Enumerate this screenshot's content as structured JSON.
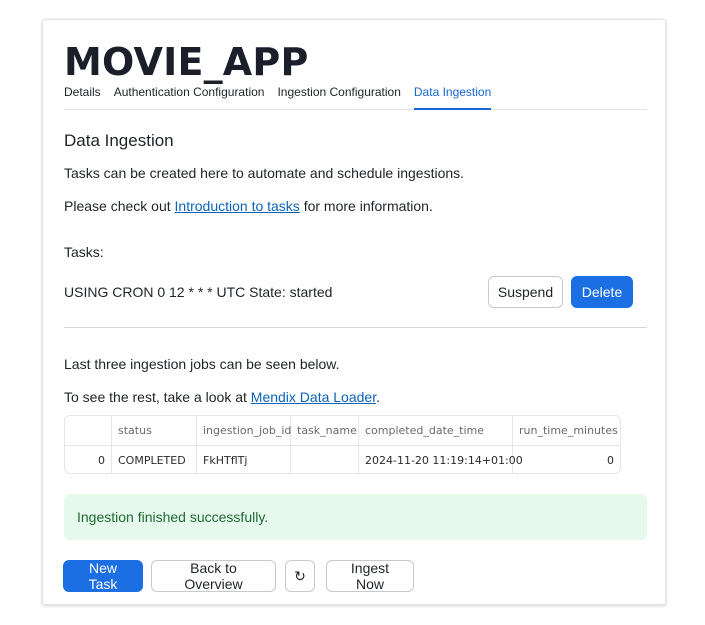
{
  "app": {
    "title": "MOVIE_APP"
  },
  "tabs": [
    {
      "label": "Details",
      "active": false
    },
    {
      "label": "Authentication Configuration",
      "active": false
    },
    {
      "label": "Ingestion Configuration",
      "active": false
    },
    {
      "label": "Data Ingestion",
      "active": true
    }
  ],
  "section": {
    "title": "Data Ingestion",
    "intro": "Tasks can be created here to automate and schedule ingestions.",
    "info_prefix": "Please check out ",
    "info_link": "Introduction to tasks",
    "info_suffix": " for more information."
  },
  "tasks": {
    "label": "Tasks:",
    "items": [
      {
        "description": "USING CRON 0 12 * * * UTC State: started",
        "suspend_label": "Suspend",
        "delete_label": "Delete"
      }
    ]
  },
  "jobs": {
    "intro": "Last three ingestion jobs can be seen below.",
    "rest_prefix": "To see the rest, take a look at ",
    "rest_link": "Mendix Data Loader",
    "rest_suffix": ".",
    "table": {
      "columns": [
        "",
        "status",
        "ingestion_job_id",
        "task_name",
        "completed_date_time",
        "run_time_minutes"
      ],
      "rows": [
        [
          "0",
          "COMPLETED",
          "FkHTflTj",
          "",
          "2024-11-20 11:19:14+01:00",
          "0"
        ]
      ]
    }
  },
  "alert": {
    "message": "Ingestion finished successfully.",
    "type": "success"
  },
  "actions": {
    "new_task": "New Task",
    "back": "Back to Overview",
    "refresh_icon": "↻",
    "ingest_now": "Ingest Now"
  },
  "colors": {
    "primary": "#1c6fe3",
    "link": "#0b63b7",
    "tab_active": "#1a66d2",
    "success_bg": "#e7f8ec",
    "success_text": "#1e6b35"
  }
}
